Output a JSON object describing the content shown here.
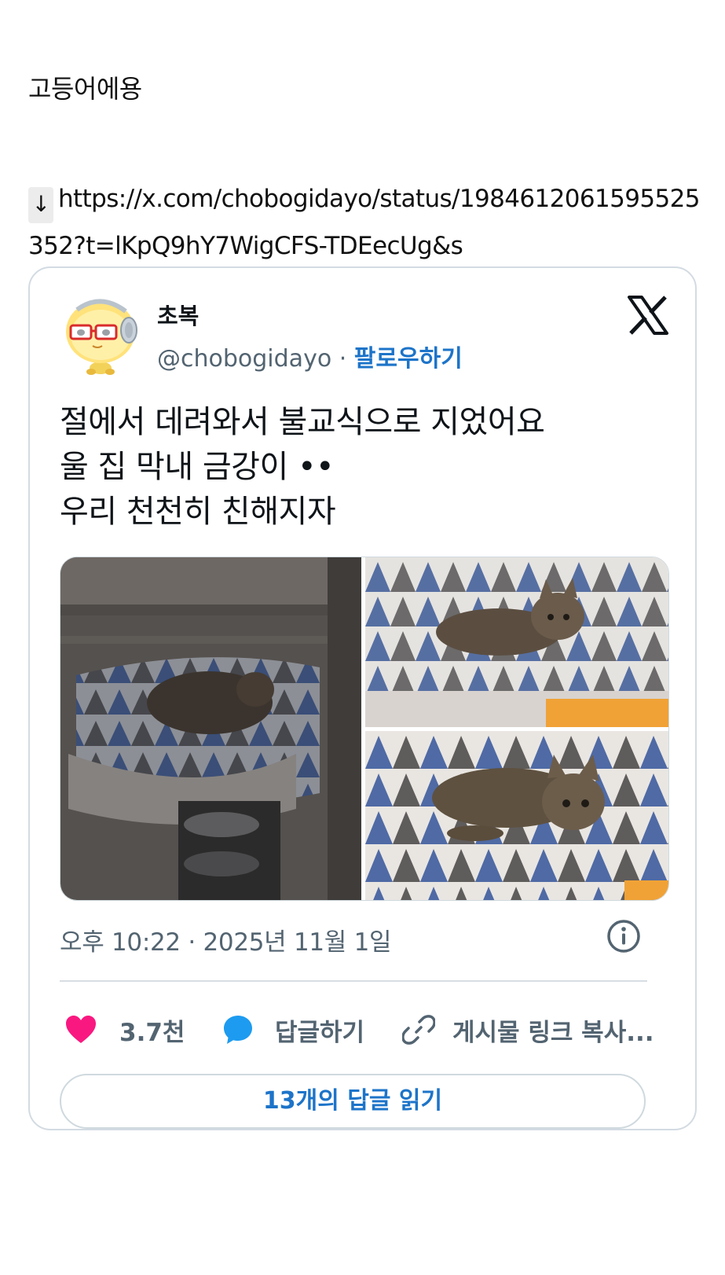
{
  "intro_text": "고등어에용",
  "link": {
    "arrow": "↓",
    "url": "https://x.com/chobogidayo/status/1984612061595525352?t=lKpQ9hY7WigCFS-TDEecUg&s"
  },
  "tweet": {
    "display_name": "초복",
    "handle": "@chobogidayo",
    "separator": " · ",
    "follow_label": "팔로우하기",
    "text_lines": [
      "절에서 데려와서 불교식으로 지었어요",
      "울 집 막내 금강이 ••",
      "우리 천천히 친해지자"
    ],
    "timestamp": "오후 10:22 · 2025년 11월 1일",
    "like_count": "3.7천",
    "reply_label": "답글하기",
    "copy_link_label": "게시물 링크 복사...",
    "read_replies_label": "13개의 답글 읽기"
  },
  "colors": {
    "link_blue": "#1d74c9",
    "like_pink": "#f91880",
    "reply_blue": "#1d9bf0",
    "muted": "#536471",
    "border": "#cfd9de"
  },
  "icons": [
    "down-arrow-icon",
    "x-logo-icon",
    "info-icon",
    "heart-icon",
    "speech-bubble-icon",
    "link-icon"
  ]
}
